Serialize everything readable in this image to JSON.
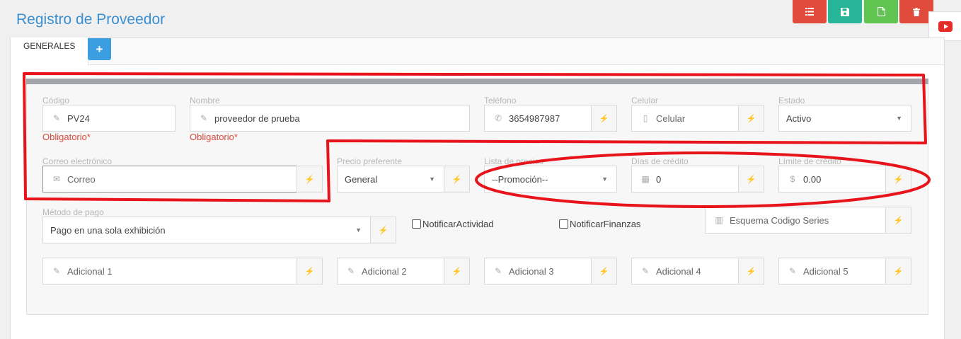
{
  "header": {
    "title": "Registro de Proveedor"
  },
  "toolbar": {
    "list_icon": "list-icon",
    "save_icon": "floppy-disk-icon",
    "new_icon": "file-icon",
    "delete_icon": "trash-icon",
    "youtube_icon": "youtube-play-icon"
  },
  "tabs": [
    {
      "label": "GENERALES"
    }
  ],
  "add_tab_label": "+",
  "form": {
    "codigo": {
      "label": "Código",
      "value": "PV24",
      "required": "Obligatorio*"
    },
    "nombre": {
      "label": "Nombre",
      "value": "proveedor de prueba",
      "required": "Obligatorio*"
    },
    "telefono": {
      "label": "Teléfono",
      "value": "3654987987"
    },
    "celular": {
      "label": "Celular",
      "placeholder": "Celular"
    },
    "estado": {
      "label": "Estado",
      "value": "Activo"
    },
    "correo": {
      "label": "Correo electrónico",
      "placeholder": "Correo"
    },
    "precio": {
      "label": "Precio preferente",
      "value": "General"
    },
    "lista": {
      "label": "Lista de precios",
      "value": "--Promoción--"
    },
    "dias": {
      "label": "Días de crédito",
      "value": "0"
    },
    "limite": {
      "label": "Límite de crédito",
      "prefix": "$",
      "value": "0.00"
    },
    "metodo": {
      "label": "Método de pago",
      "value": "Pago en una sola exhibición"
    },
    "notificar_actividad": {
      "label": "NotificarActividad",
      "checked": false
    },
    "notificar_finanzas": {
      "label": "NotificarFinanzas",
      "checked": false
    },
    "esquema": {
      "placeholder": "Esquema Codigo Series"
    },
    "adicionales": [
      {
        "placeholder": "Adicional 1"
      },
      {
        "placeholder": "Adicional 2"
      },
      {
        "placeholder": "Adicional 3"
      },
      {
        "placeholder": "Adicional 4"
      },
      {
        "placeholder": "Adicional 5"
      }
    ]
  },
  "colors": {
    "title": "#3a8fd0",
    "btn_red": "#e04b3b",
    "btn_teal": "#26b596",
    "btn_green": "#5fc550",
    "btn_blue": "#3b9ee0",
    "required": "#d84b3c",
    "annotation": "#e8141b"
  }
}
